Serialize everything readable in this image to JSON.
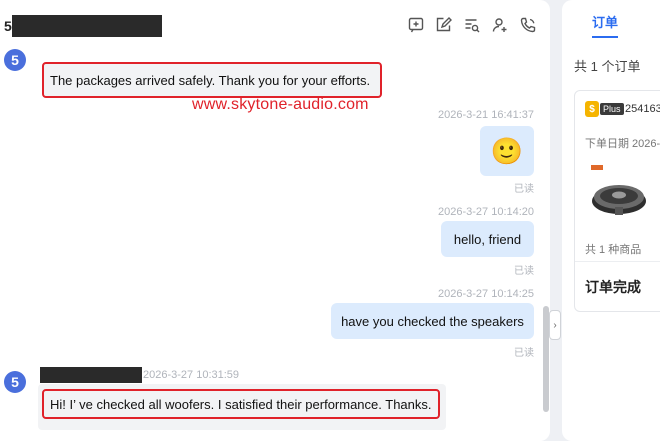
{
  "header": {
    "first_char": "5"
  },
  "toolbar": {
    "icons": [
      "add-note-icon",
      "edit-icon",
      "search-list-icon",
      "add-contact-icon",
      "phone-icon"
    ]
  },
  "messages": {
    "m1": {
      "avatar": "5",
      "text": "The packages arrived safely. Thank you for your efforts."
    },
    "m2": {
      "timestamp": "2026-3-21 16:41:37",
      "emoji": "🙂",
      "status": "已读"
    },
    "m3": {
      "timestamp": "2026-3-27 10:14:20",
      "text": "hello, friend",
      "status": "已读"
    },
    "m4": {
      "timestamp": "2026-3-27 10:14:25",
      "text": "have you checked the speakers",
      "status": "已读"
    },
    "m5": {
      "avatar": "5",
      "timestamp": "2026-3-27 10:31:59",
      "text": "Hi! I’ ve checked all woofers. I satisfied their performance. Thanks."
    }
  },
  "watermark": "www.skytone-audio.com",
  "side": {
    "tab": "订单",
    "count": "共 1 个订单",
    "order": {
      "badge_coin": "$",
      "badge_text": "Plus",
      "id": "254163",
      "date": "下单日期 2026-",
      "items": "共 1 种商品",
      "status": "订单完成"
    }
  },
  "colors": {
    "accent": "#2b6cf0",
    "highlight": "#e0222a",
    "avatar": "#4a6fdc",
    "outgoing": "#dcebfd"
  }
}
